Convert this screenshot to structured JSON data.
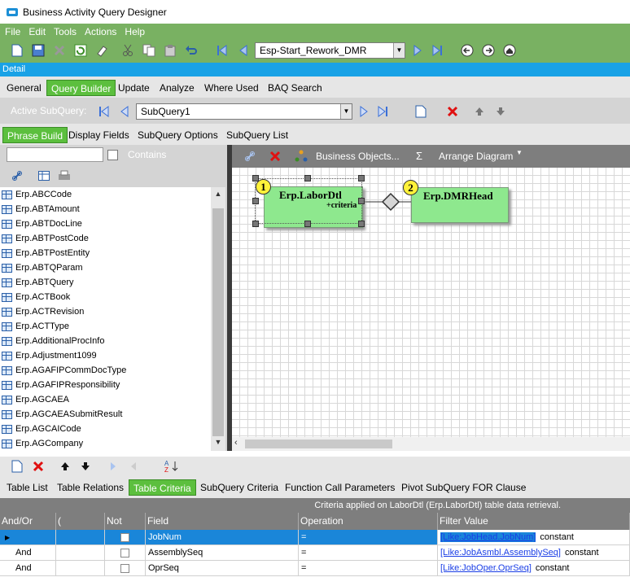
{
  "window": {
    "title": "Business Activity Query Designer"
  },
  "menu": [
    "File",
    "Edit",
    "Tools",
    "Actions",
    "Help"
  ],
  "toolbar": {
    "query_id": "Esp-Start_Rework_DMR"
  },
  "detail_label": "Detail",
  "main_tabs": [
    {
      "label": "General",
      "selected": false
    },
    {
      "label": "Query Builder",
      "selected": true
    },
    {
      "label": "Update",
      "selected": false
    },
    {
      "label": "Analyze",
      "selected": false
    },
    {
      "label": "Where Used",
      "selected": false
    },
    {
      "label": "BAQ Search",
      "selected": false
    }
  ],
  "subquery_bar": {
    "label": "Active SubQuery:",
    "value": "SubQuery1"
  },
  "sub_tabs": [
    {
      "label": "Phrase Build",
      "selected": true
    },
    {
      "label": "Display Fields",
      "selected": false
    },
    {
      "label": "SubQuery Options",
      "selected": false
    },
    {
      "label": "SubQuery List",
      "selected": false
    }
  ],
  "left_panel": {
    "search_value": "",
    "contains_label": "Contains",
    "tables": [
      "Erp.ABCCode",
      "Erp.ABTAmount",
      "Erp.ABTDocLine",
      "Erp.ABTPostCode",
      "Erp.ABTPostEntity",
      "Erp.ABTQParam",
      "Erp.ABTQuery",
      "Erp.ACTBook",
      "Erp.ACTRevision",
      "Erp.ACTType",
      "Erp.AdditionalProcInfo",
      "Erp.Adjustment1099",
      "Erp.AGAFIPCommDocType",
      "Erp.AGAFIPResponsibility",
      "Erp.AGCAEA",
      "Erp.AGCAEASubmitResult",
      "Erp.AGCAICode",
      "Erp.AGCompany"
    ]
  },
  "canvas_toolbar": {
    "business_objects": "Business Objects...",
    "sigma": "Σ",
    "arrange": "Arrange Diagram"
  },
  "diagram": {
    "nodes": [
      {
        "num": "1",
        "name": "Erp.LaborDtl",
        "sub": "+criteria"
      },
      {
        "num": "2",
        "name": "Erp.DMRHead",
        "sub": ""
      }
    ]
  },
  "bottom_tabs": [
    {
      "label": "Table List",
      "selected": false
    },
    {
      "label": "Table Relations",
      "selected": false
    },
    {
      "label": "Table Criteria",
      "selected": true
    },
    {
      "label": "SubQuery Criteria",
      "selected": false
    },
    {
      "label": "Function Call Parameters",
      "selected": false
    },
    {
      "label": "Pivot SubQuery FOR Clause",
      "selected": false
    }
  ],
  "criteria_info": "Criteria applied on LaborDtl (Erp.LaborDtl) table data retrieval.",
  "criteria_grid": {
    "columns": [
      "And/Or",
      "(",
      "Not",
      "Field",
      "Operation",
      "Filter Value"
    ],
    "rows": [
      {
        "andor": "",
        "paren": "",
        "field": "JobNum",
        "op": "=",
        "link": "[Like:JobHead.JobNum]",
        "suffix": "constant",
        "selected": true
      },
      {
        "andor": "And",
        "paren": "",
        "field": "AssemblySeq",
        "op": "=",
        "link": "[Like:JobAsmbl.AssemblySeq]",
        "suffix": "constant",
        "selected": false
      },
      {
        "andor": "And",
        "paren": "",
        "field": "OprSeq",
        "op": "=",
        "link": "[Like:JobOper.OprSeq]",
        "suffix": "constant",
        "selected": false
      }
    ]
  }
}
